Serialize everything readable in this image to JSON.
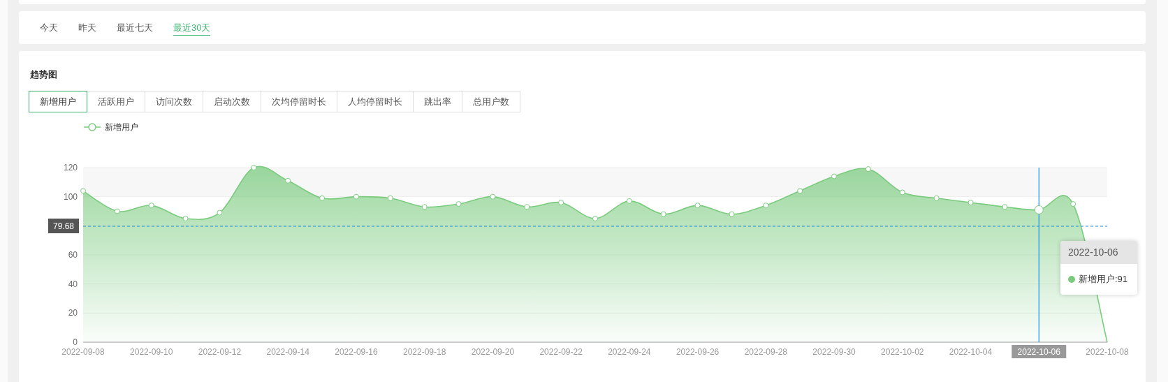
{
  "time_tabs": [
    {
      "label": "今天",
      "selected": false
    },
    {
      "label": "昨天",
      "selected": false
    },
    {
      "label": "最近七天",
      "selected": false
    },
    {
      "label": "最近30天",
      "selected": true
    }
  ],
  "panel": {
    "title": "趋势图",
    "metric_tabs": [
      {
        "label": "新增用户",
        "selected": true
      },
      {
        "label": "活跃用户",
        "selected": false
      },
      {
        "label": "访问次数",
        "selected": false
      },
      {
        "label": "启动次数",
        "selected": false
      },
      {
        "label": "次均停留时长",
        "selected": false
      },
      {
        "label": "人均停留时长",
        "selected": false
      },
      {
        "label": "跳出率",
        "selected": false
      },
      {
        "label": "总用户数",
        "selected": false
      }
    ],
    "chart_data": {
      "type": "area",
      "x": [
        "2022-09-08",
        "2022-09-09",
        "2022-09-10",
        "2022-09-11",
        "2022-09-12",
        "2022-09-13",
        "2022-09-14",
        "2022-09-15",
        "2022-09-16",
        "2022-09-17",
        "2022-09-18",
        "2022-09-19",
        "2022-09-20",
        "2022-09-21",
        "2022-09-22",
        "2022-09-23",
        "2022-09-24",
        "2022-09-25",
        "2022-09-26",
        "2022-09-27",
        "2022-09-28",
        "2022-09-29",
        "2022-09-30",
        "2022-10-01",
        "2022-10-02",
        "2022-10-03",
        "2022-10-04",
        "2022-10-05",
        "2022-10-06",
        "2022-10-07",
        "2022-10-08"
      ],
      "series": [
        {
          "name": "新增用户",
          "color": "#7acb7e",
          "values": [
            104,
            90,
            94,
            85,
            89,
            120,
            111,
            99,
            100,
            99,
            93,
            95,
            100,
            93,
            96,
            85,
            97,
            88,
            94,
            88,
            94,
            104,
            114,
            119,
            103,
            99,
            96,
            93,
            91,
            95,
            0
          ]
        }
      ],
      "xticks": [
        "2022-09-08",
        "2022-09-10",
        "2022-09-12",
        "2022-09-14",
        "2022-09-16",
        "2022-09-18",
        "2022-09-20",
        "2022-09-22",
        "2022-09-24",
        "2022-09-26",
        "2022-09-28",
        "2022-09-30",
        "2022-10-02",
        "2022-10-04",
        "2022-10-06",
        "2022-10-08"
      ],
      "xlim": [
        "2022-09-08",
        "2022-10-08"
      ],
      "ylim": [
        0,
        120
      ],
      "yticks": [
        0,
        20,
        40,
        60,
        100,
        120
      ],
      "grid": true,
      "bands": [
        {
          "axis": "y",
          "from": 100,
          "to": 120
        }
      ],
      "ref_lines": [
        {
          "axis": "y",
          "value": 79.68,
          "label": "79.68"
        },
        {
          "axis": "x",
          "value": "2022-10-06"
        }
      ]
    },
    "tooltip": {
      "title": "2022-10-06",
      "text": "新增用户:91"
    }
  }
}
